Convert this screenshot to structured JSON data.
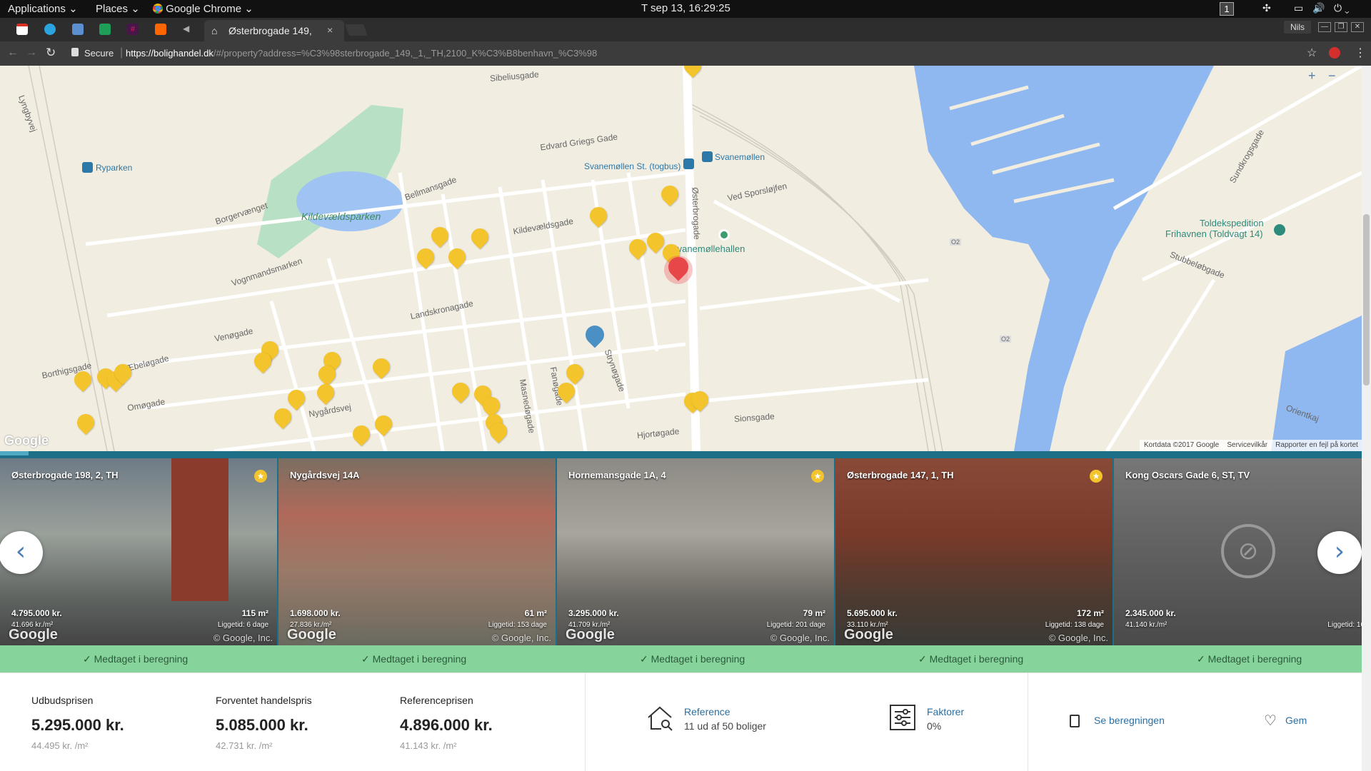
{
  "system_bar": {
    "applications": "Applications",
    "places": "Places",
    "browser": "Google Chrome",
    "clock": "T  sep 13, 16:29:25",
    "workspace": "1"
  },
  "browser": {
    "tab_title": "Østerbrogade 149,",
    "tab_close": "×",
    "profile": "Nils",
    "secure_label": "Secure",
    "url_host": "https://bolighandel.dk",
    "url_path": "/#/property?address=%C3%98sterbrogade_149,_1,_TH,2100_K%C3%B8benhavn_%C3%98"
  },
  "map": {
    "labels": {
      "kildevaeldsparken": "Kildevældsparken",
      "ryparken": "Ryparken",
      "svanemollen_st": "Svanemøllen St. (togbus)",
      "svanemollen": "Svanemøllen",
      "svanemollehallen": "Svanemøllehallen",
      "toldekspedition_1": "Toldekspedition",
      "toldekspedition_2": "Frihavnen (Toldvagt 14)",
      "edvard_griegs": "Edvard Griegs Gade",
      "sibeliusgade": "Sibeliusgade",
      "kildevaeldsgade": "Kildevældsgade",
      "landskronagade": "Landskronagade",
      "vognmandsmarken": "Vognmandsmarken",
      "bellmansgade": "Bellmansgade",
      "osterbrogade": "Østerbrogade",
      "borgervaenget": "Borgervænget",
      "venogade": "Venøgade",
      "borthigsgade": "Borthigsgade",
      "aebelogade": "Æbeløgade",
      "omogade": "Omøgade",
      "nygaardsvej": "Nygårdsvej",
      "hjortogade": "Hjortøgade",
      "sionsgade": "Sionsgade",
      "strynogade": "Strynøgade",
      "fanogade": "Fanøgade",
      "masnedogade": "Masnedøgade",
      "ved_sporsloejfen": "Ved Sporsløjfen",
      "stubbelobgade": "Stubbeløbgade",
      "sundkrogsgade": "Sundkrogsgade",
      "oerestad": "Orientkaj",
      "lyngbyvej": "Lyngbyvej",
      "o2_1": "O2",
      "o2_2": "O2"
    },
    "zoom_in": "+",
    "zoom_out": "−",
    "google_logo": "Google",
    "attribution": {
      "kortdata": "Kortdata ©2017 Google",
      "service": "Servicevilkår",
      "report": "Rapporter en fejl på kortet"
    }
  },
  "cards": [
    {
      "address": "Østerbrogade 198, 2, TH",
      "price": "4.795.000 kr.",
      "price_per_m2": "41.696 kr./m²",
      "area": "115 m²",
      "days": "Liggetid: 6 dage",
      "starred": true
    },
    {
      "address": "Nygårdsvej 14A",
      "price": "1.698.000 kr.",
      "price_per_m2": "27.836 kr./m²",
      "area": "61 m²",
      "days": "Liggetid: 153 dage",
      "starred": false
    },
    {
      "address": "Hornemansgade 1A, 4",
      "price": "3.295.000 kr.",
      "price_per_m2": "41.709 kr./m²",
      "area": "79 m²",
      "days": "Liggetid: 201 dage",
      "starred": true
    },
    {
      "address": "Østerbrogade 147, 1, TH",
      "price": "5.695.000 kr.",
      "price_per_m2": "33.110 kr./m²",
      "area": "172 m²",
      "days": "Liggetid: 138 dage",
      "starred": true
    },
    {
      "address": "Kong Oscars Gade 6, ST, TV",
      "price": "2.345.000 kr.",
      "price_per_m2": "41.140 kr./m²",
      "area": "",
      "days": "Liggetid: 16",
      "starred": false
    }
  ],
  "card_watermark": "Google",
  "card_copyright": "© Google, Inc.",
  "green_bar_label": "✓  Medtaget i beregning",
  "stats": {
    "udbud_label": "Udbudsprisen",
    "udbud_value": "5.295.000 kr.",
    "udbud_sub": "44.495 kr. /m²",
    "forventet_label": "Forventet handelspris",
    "forventet_value": "5.085.000 kr.",
    "forventet_sub": "42.731 kr. /m²",
    "reference_label": "Referenceprisen",
    "reference_value": "4.896.000 kr.",
    "reference_sub": "41.143 kr. /m²"
  },
  "features": {
    "reference_title": "Reference",
    "reference_sub": "11 ud af 50 boliger",
    "faktorer_title": "Faktorer",
    "faktorer_sub": "0%",
    "se_beregningen": "Se beregningen",
    "gem": "Gem"
  },
  "colors": {
    "accent_blue": "#2a6fa3",
    "green_bar": "#86d39c",
    "pin_yellow": "#f3c42b",
    "pin_red": "#e8474a",
    "water": "#8fb8f0"
  }
}
